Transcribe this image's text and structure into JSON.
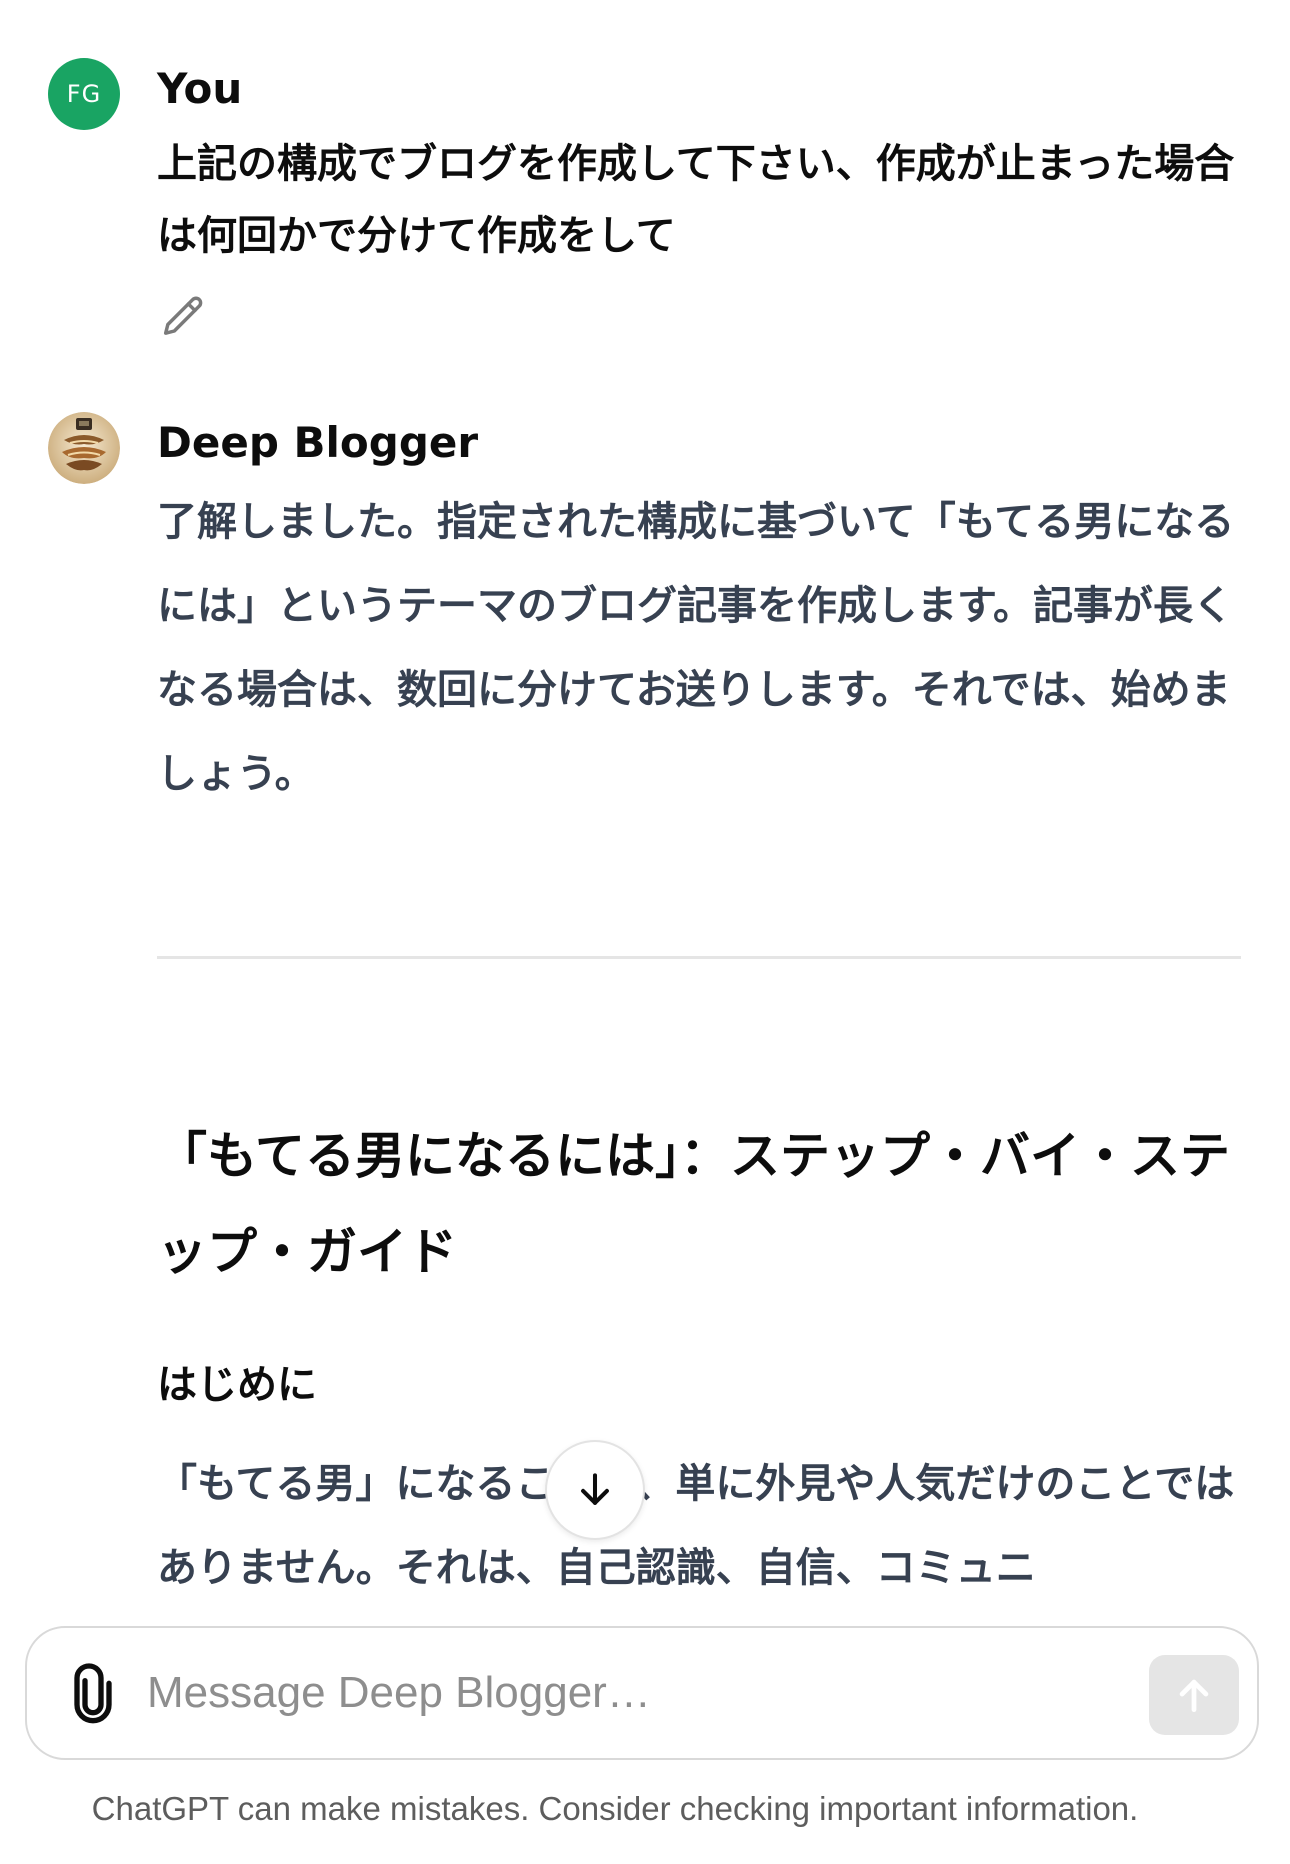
{
  "user_message": {
    "avatar_initials": "FG",
    "avatar_color": "#19a463",
    "author": "You",
    "text": "上記の構成でブログを作成して下さい、作成が止まった場合は何回かで分けて作成をして",
    "edit_icon": "pencil-icon"
  },
  "bot_message": {
    "avatar_icon": "deep-blogger-avatar",
    "author": "Deep Blogger",
    "intro": "了解しました。指定された構成に基づいて「もてる男になるには」というテーマのブログ記事を作成します。記事が長くなる場合は、数回に分けてお送りします。それでは、始めましょう。",
    "article_title": "「もてる男になるには」：ステップ・バイ・ステップ・ガイド",
    "section_heading": "はじめに",
    "body": "「もてる男」になることは、単に外見や人気だけのことではありません。それは、自己認識、自信、コミュニ"
  },
  "scroll_button": {
    "icon": "arrow-down-icon"
  },
  "composer": {
    "attach_icon": "paperclip-icon",
    "placeholder": "Message Deep Blogger…",
    "send_icon": "arrow-up-icon"
  },
  "footer": {
    "disclaimer": "ChatGPT can make mistakes. Consider checking important information."
  }
}
